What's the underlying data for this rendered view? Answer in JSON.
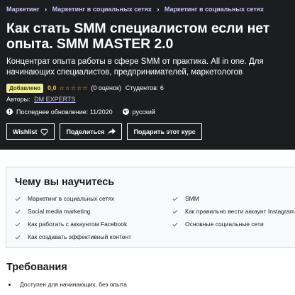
{
  "breadcrumbs": [
    "Маркетинг",
    "Маркетинг в социальных сетях",
    "Маркетинг в социальных сетях"
  ],
  "course": {
    "title": "Как стать SMM специалистом если нет опыта. SMM MASTER 2.0",
    "subtitle": "Концентрат опыта работы в сфере SMM от практика. All in one. Для начинающих специалистов, предпринимателей, маркетологов",
    "badge": "Добавлено",
    "rating": "0,0",
    "stars": "☆☆☆☆☆",
    "rating_count": "(0 оценок)",
    "students": "Студентов: 6",
    "authors_label": "Авторы:",
    "author_name": "DM EXPERTS",
    "last_update": "Последнее обновление: 11/2020",
    "language": "русский"
  },
  "actions": {
    "wishlist": "Wishlist",
    "share": "Поделиться",
    "gift": "Подарить этот курс"
  },
  "learn": {
    "title": "Чему вы научитесь",
    "left": [
      "Маркетинг в социальных сетях",
      "Social media marketing",
      "Как работать с аккаунтом Facebook",
      "Как создавать эффективный контент"
    ],
    "right": [
      "SMM",
      "Как правильно вести аккаунт Instagram",
      "Основные социальные сети"
    ]
  },
  "requirements": {
    "title": "Требования",
    "items": [
      "Доступен для начинающих, без опыта"
    ]
  },
  "colors": {
    "hero_bg": "#1c1d1f",
    "link_purple": "#cec0fc",
    "rating_gold": "#f4c150",
    "badge_bg": "#eceb98"
  }
}
